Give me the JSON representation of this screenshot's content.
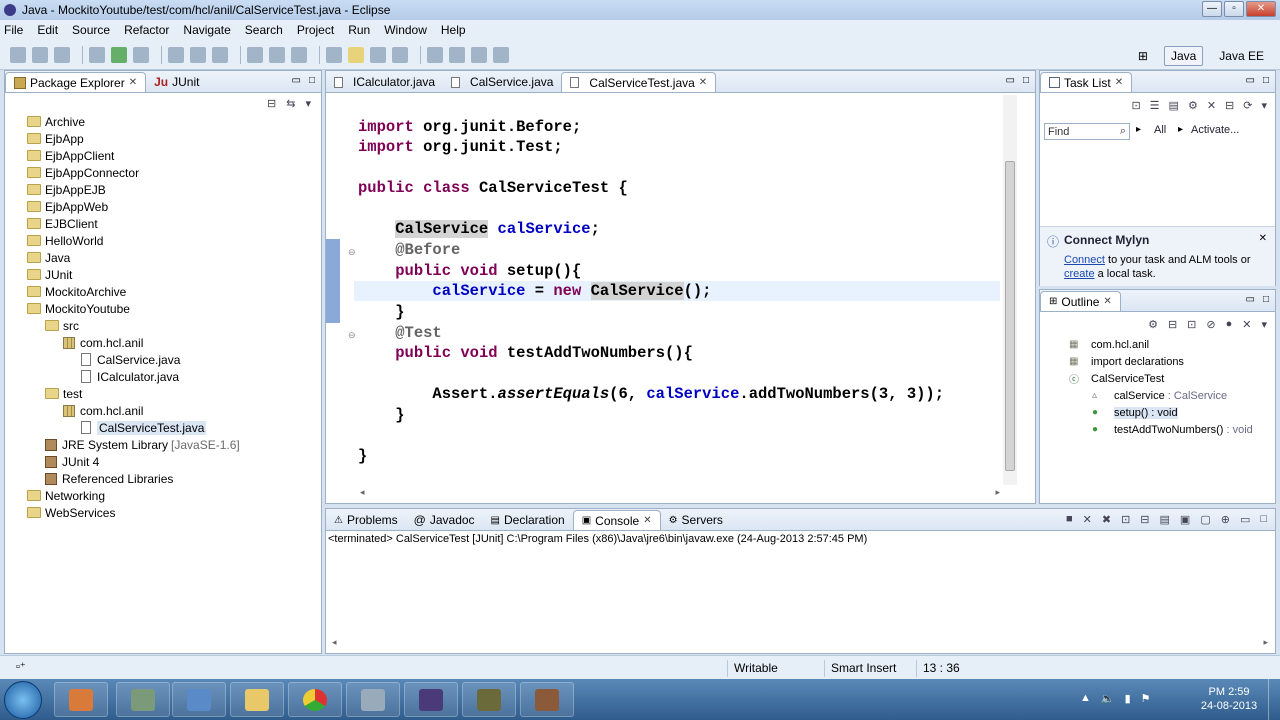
{
  "window": {
    "title": "Java - MockitoYoutube/test/com/hcl/anil/CalServiceTest.java - Eclipse"
  },
  "menu": [
    "File",
    "Edit",
    "Source",
    "Refactor",
    "Navigate",
    "Search",
    "Project",
    "Run",
    "Window",
    "Help"
  ],
  "perspectives": {
    "java": "Java",
    "javaee": "Java EE"
  },
  "left_panel": {
    "tabs": [
      "Package Explorer",
      "JUnit"
    ],
    "tree": [
      {
        "label": "Archive",
        "icon": "folder",
        "indent": 0
      },
      {
        "label": "EjbApp",
        "icon": "folder",
        "indent": 0
      },
      {
        "label": "EjbAppClient",
        "icon": "folder",
        "indent": 0
      },
      {
        "label": "EjbAppConnector",
        "icon": "folder",
        "indent": 0
      },
      {
        "label": "EjbAppEJB",
        "icon": "folder",
        "indent": 0
      },
      {
        "label": "EjbAppWeb",
        "icon": "folder",
        "indent": 0
      },
      {
        "label": "EJBClient",
        "icon": "folder",
        "indent": 0
      },
      {
        "label": "HelloWorld",
        "icon": "folder",
        "indent": 0
      },
      {
        "label": "Java",
        "icon": "folder",
        "indent": 0
      },
      {
        "label": "JUnit",
        "icon": "folder",
        "indent": 0
      },
      {
        "label": "MockitoArchive",
        "icon": "folder",
        "indent": 0
      },
      {
        "label": "MockitoYoutube",
        "icon": "folder",
        "indent": 0
      },
      {
        "label": "src",
        "icon": "folder",
        "indent": 1
      },
      {
        "label": "com.hcl.anil",
        "icon": "package",
        "indent": 2
      },
      {
        "label": "CalService.java",
        "icon": "file",
        "indent": 3
      },
      {
        "label": "ICalculator.java",
        "icon": "file",
        "indent": 3
      },
      {
        "label": "test",
        "icon": "folder",
        "indent": 1
      },
      {
        "label": "com.hcl.anil",
        "icon": "package",
        "indent": 2
      },
      {
        "label": "CalServiceTest.java",
        "icon": "file",
        "indent": 3,
        "selected": true
      },
      {
        "label": "JRE System Library",
        "suffix": "[JavaSE-1.6]",
        "icon": "jar",
        "indent": 1
      },
      {
        "label": "JUnit 4",
        "icon": "jar",
        "indent": 1
      },
      {
        "label": "Referenced Libraries",
        "icon": "jar",
        "indent": 1
      },
      {
        "label": "Networking",
        "icon": "folder",
        "indent": 0
      },
      {
        "label": "WebServices",
        "icon": "folder",
        "indent": 0
      }
    ]
  },
  "editor": {
    "tabs": [
      "ICalculator.java",
      "CalService.java",
      "CalServiceTest.java"
    ],
    "active_tab": "CalServiceTest.java"
  },
  "task_list": {
    "tab": "Task List",
    "find_placeholder": "Find",
    "all": "All",
    "activate": "Activate...",
    "mylyn_title": "Connect Mylyn",
    "mylyn_connect": "Connect",
    "mylyn_text1": " to your task and ALM tools or",
    "mylyn_create": "create",
    "mylyn_text2": " a local task."
  },
  "outline": {
    "tab": "Outline",
    "items": [
      {
        "label": "com.hcl.anil",
        "detail": "",
        "indent": 0
      },
      {
        "label": "import declarations",
        "detail": "",
        "indent": 0
      },
      {
        "label": "CalServiceTest",
        "detail": "",
        "indent": 0
      },
      {
        "label": "calService",
        "detail": " : CalService",
        "indent": 1
      },
      {
        "label": "setup() : void",
        "detail": "",
        "indent": 1,
        "selected": true
      },
      {
        "label": "testAddTwoNumbers()",
        "detail": " : void",
        "indent": 1
      }
    ]
  },
  "bottom_panel": {
    "tabs": [
      "Problems",
      "Javadoc",
      "Declaration",
      "Console",
      "Servers"
    ],
    "active_tab": "Console",
    "console_text": "<terminated> CalServiceTest [JUnit] C:\\Program Files (x86)\\Java\\jre6\\bin\\javaw.exe (24-Aug-2013 2:57:45 PM)"
  },
  "status_bar": {
    "writable": "Writable",
    "insert_mode": "Smart Insert",
    "position": "13 : 36"
  },
  "taskbar": {
    "time": "PM 2:59",
    "date": "24-08-2013"
  },
  "colors": {
    "keyword": "#7f0055",
    "field": "#0000c0",
    "annotation": "#646464",
    "selection": "#dbe6f5"
  }
}
